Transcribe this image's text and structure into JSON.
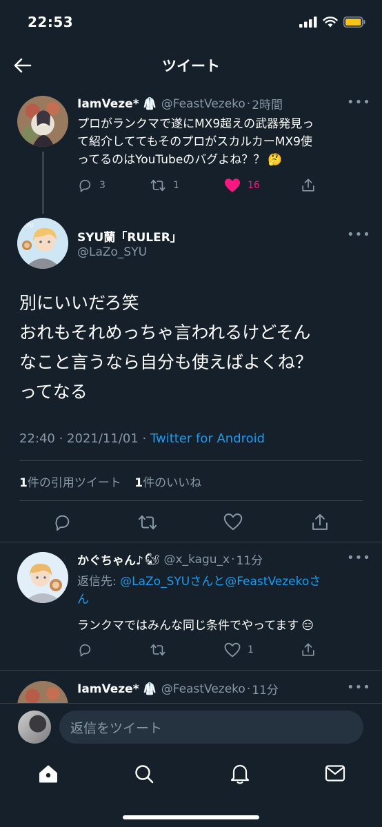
{
  "status_bar": {
    "time": "22:53"
  },
  "header": {
    "title": "ツイート"
  },
  "parent_tweet": {
    "name": "IamVeze*",
    "handle": "@FeastVezeko",
    "dot": "·",
    "time": "2時間",
    "lines": [
      "プロがランクマで遂にMX9超えの武器発見っ",
      "て紹介しててもそのプロがスカルカーMX9使",
      "ってるのはYouTubeのバグよね？？"
    ],
    "emoji": "🤔",
    "replies": "3",
    "retweets": "1",
    "likes": "16"
  },
  "main_tweet": {
    "name": "SYU蘭「RULER」",
    "handle": "@LaZo_SYU",
    "lines": [
      "別にいいだろ笑",
      "おれもそれめっちゃ言われるけどそん",
      "なこと言うなら自分も使えばよくね？",
      "ってなる"
    ],
    "timestamp": "22:40 · 2021/11/01 · ",
    "source": "Twitter for Android",
    "quote_count": "1",
    "quote_label": "件の引用ツイート",
    "like_count": "1",
    "like_label": "件のいいね"
  },
  "reply1": {
    "name": "かぐちゃん♪",
    "name_emoji": "🐿",
    "handle": "@x_kagu_x",
    "dot": "·",
    "time": "11分",
    "reply_prefix": "返信先: ",
    "mention1": "@LaZo_SYU",
    "san1": "さんと",
    "mention2": "@FeastVezeko",
    "san2": "さ",
    "san2b": "ん",
    "text": "ランクマではみんな同じ条件でやってます",
    "emoji": "😑",
    "likes": "1"
  },
  "reply2": {
    "name": "IamVeze*",
    "handle": "@FeastVezeko",
    "dot": "·",
    "time": "11分"
  },
  "composer": {
    "placeholder": "返信をツイート"
  },
  "colors": {
    "background": "#15202b",
    "accent": "#1d9bf0",
    "like": "#f91880",
    "muted": "#8899a6",
    "divider": "#38444d"
  }
}
